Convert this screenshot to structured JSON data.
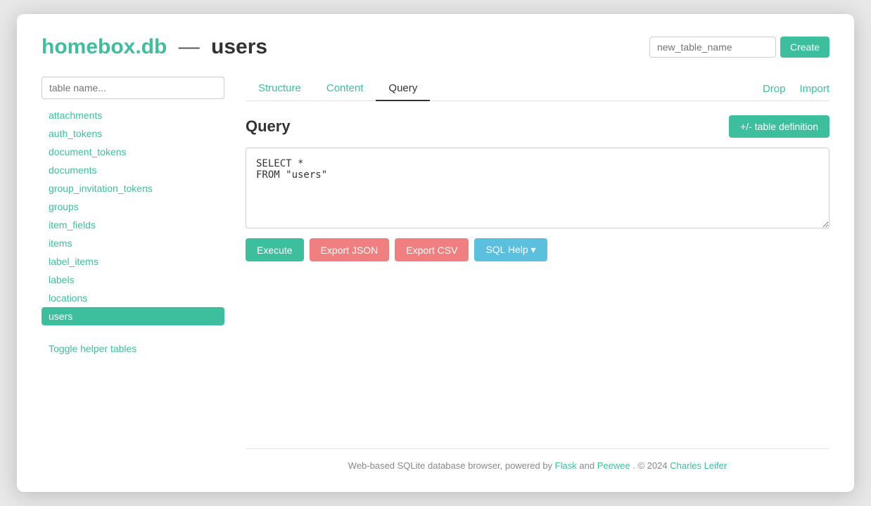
{
  "header": {
    "title_db": "homebox.db",
    "title_separator": "—",
    "title_table": "users",
    "new_table_placeholder": "new_table_name",
    "create_label": "Create"
  },
  "sidebar": {
    "search_placeholder": "table name...",
    "items": [
      {
        "label": "attachments",
        "active": false
      },
      {
        "label": "auth_tokens",
        "active": false
      },
      {
        "label": "document_tokens",
        "active": false
      },
      {
        "label": "documents",
        "active": false
      },
      {
        "label": "group_invitation_tokens",
        "active": false
      },
      {
        "label": "groups",
        "active": false
      },
      {
        "label": "item_fields",
        "active": false
      },
      {
        "label": "items",
        "active": false
      },
      {
        "label": "label_items",
        "active": false
      },
      {
        "label": "labels",
        "active": false
      },
      {
        "label": "locations",
        "active": false
      },
      {
        "label": "users",
        "active": true
      }
    ],
    "toggle_label": "Toggle helper tables"
  },
  "tabs": {
    "items": [
      {
        "label": "Structure",
        "active": false
      },
      {
        "label": "Content",
        "active": false
      },
      {
        "label": "Query",
        "active": true
      }
    ],
    "actions": [
      {
        "label": "Drop"
      },
      {
        "label": "Import"
      }
    ]
  },
  "query": {
    "title": "Query",
    "table_def_label": "+/- table definition",
    "sql_text": "SELECT *\nFROM \"users\"",
    "buttons": {
      "execute": "Execute",
      "export_json": "Export JSON",
      "export_csv": "Export CSV",
      "sql_help": "SQL Help ▾"
    }
  },
  "footer": {
    "text_before": "Web-based SQLite database browser, powered by",
    "flask_label": "Flask",
    "text_mid": "and",
    "peewee_label": "Peewee",
    "text_after": ". © 2024",
    "author_label": "Charles Leifer"
  }
}
